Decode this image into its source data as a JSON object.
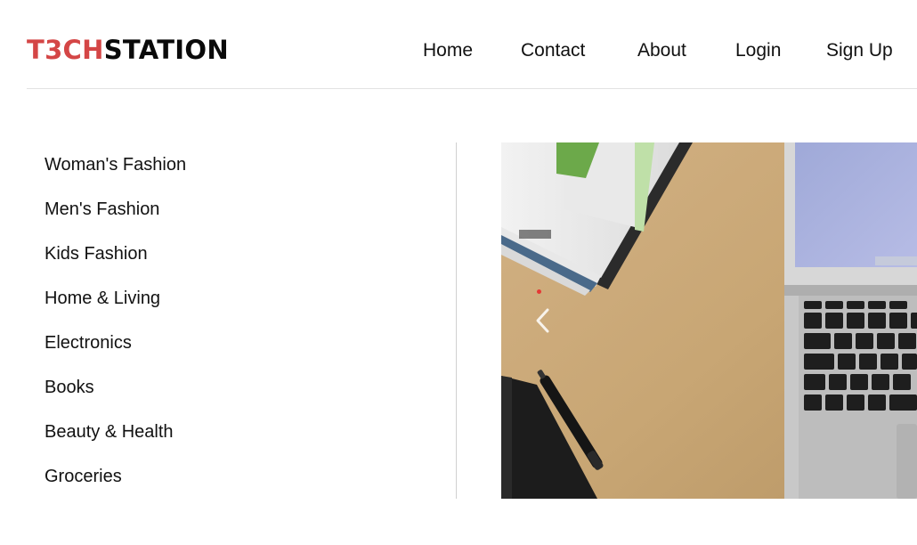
{
  "header": {
    "logo_red": "T3CH",
    "logo_dark": "STATION",
    "nav": [
      "Home",
      "Contact",
      "About",
      "Login",
      "Sign Up"
    ]
  },
  "sidebar": {
    "categories": [
      "Woman's Fashion",
      "Men's Fashion",
      "Kids Fashion",
      "Home & Living",
      "Electronics",
      "Books",
      "Beauty & Health",
      "Groceries"
    ]
  },
  "banner": {
    "prev_icon": "chevron-left-icon",
    "indicator_color": "#e53935"
  },
  "colors": {
    "brand_red": "#d44646",
    "text": "#111111",
    "divider": "#e2e2e2"
  }
}
